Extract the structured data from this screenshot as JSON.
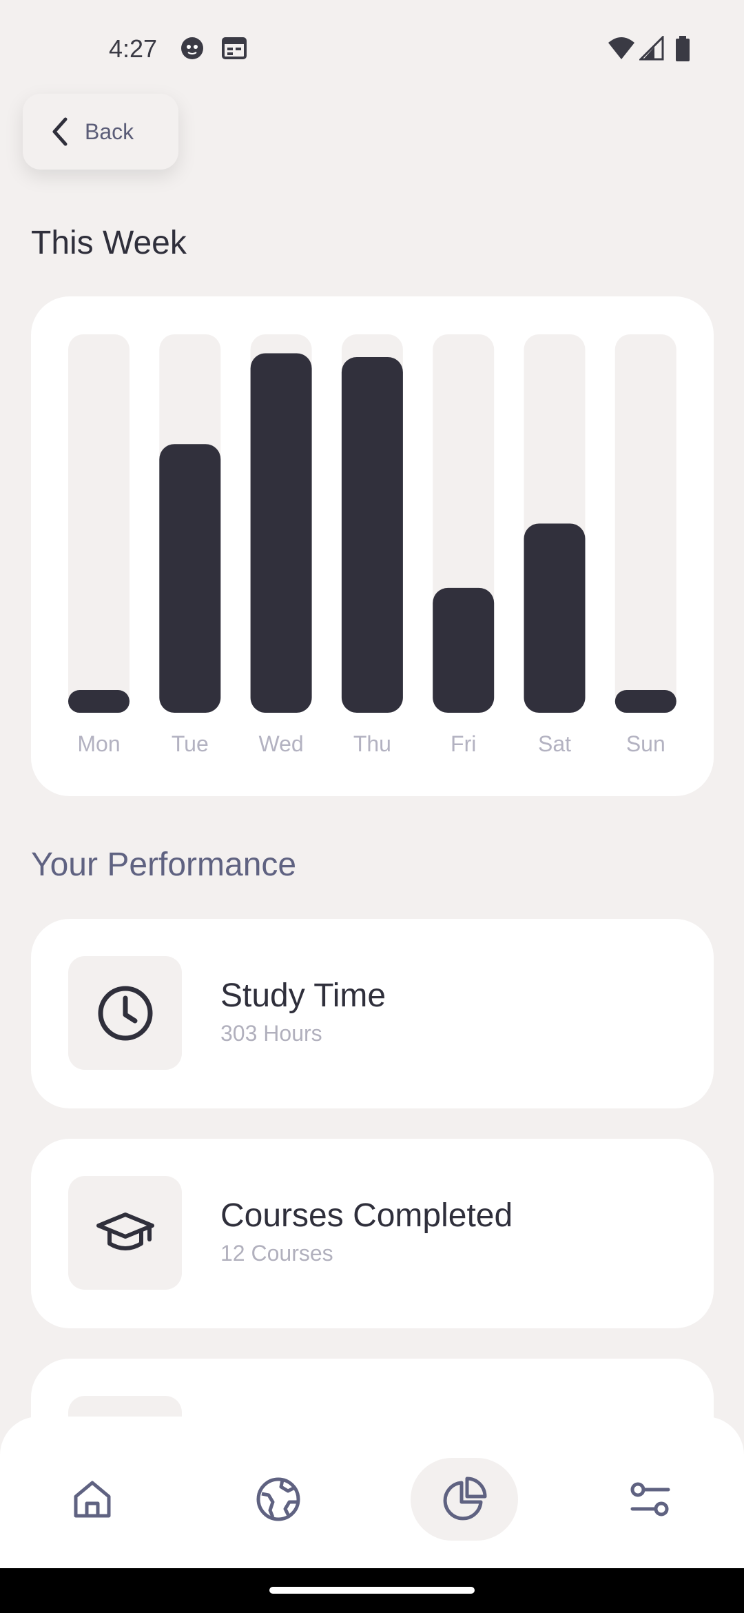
{
  "status_bar": {
    "time": "4:27",
    "icons": [
      "face-notification-icon",
      "calendar-notification-icon",
      "wifi-icon",
      "signal-icon",
      "battery-icon"
    ]
  },
  "back_button": {
    "label": "Back",
    "icon": "chevron-left-icon"
  },
  "week_section": {
    "title": "This Week"
  },
  "chart_data": {
    "type": "bar",
    "categories": [
      "Mon",
      "Tue",
      "Wed",
      "Thu",
      "Fri",
      "Sat",
      "Sun"
    ],
    "values": [
      0.06,
      0.71,
      0.95,
      0.94,
      0.33,
      0.5,
      0.06
    ],
    "ylim": [
      0,
      1
    ],
    "title": "",
    "xlabel": "",
    "ylabel": "",
    "grid": false,
    "bar_color": "#31303c",
    "track_color": "#f3f0ef",
    "label_color": "#b3b2c1"
  },
  "performance_section": {
    "title": "Your Performance",
    "cards": [
      {
        "title": "Study Time",
        "value": "303 Hours",
        "icon": "clock-icon"
      },
      {
        "title": "Courses Completed",
        "value": "12 Courses",
        "icon": "graduation-cap-icon"
      }
    ]
  },
  "bottom_nav": {
    "items": [
      "home-icon",
      "globe-icon",
      "pie-chart-icon",
      "sliders-icon"
    ],
    "active": "pie-chart-icon"
  },
  "colors": {
    "background": "#f3f0ef",
    "card": "#ffffff",
    "primary_text": "#2f2f3b",
    "secondary_text": "#5f6281",
    "muted_text": "#b1b0bd",
    "bar": "#31303c"
  }
}
